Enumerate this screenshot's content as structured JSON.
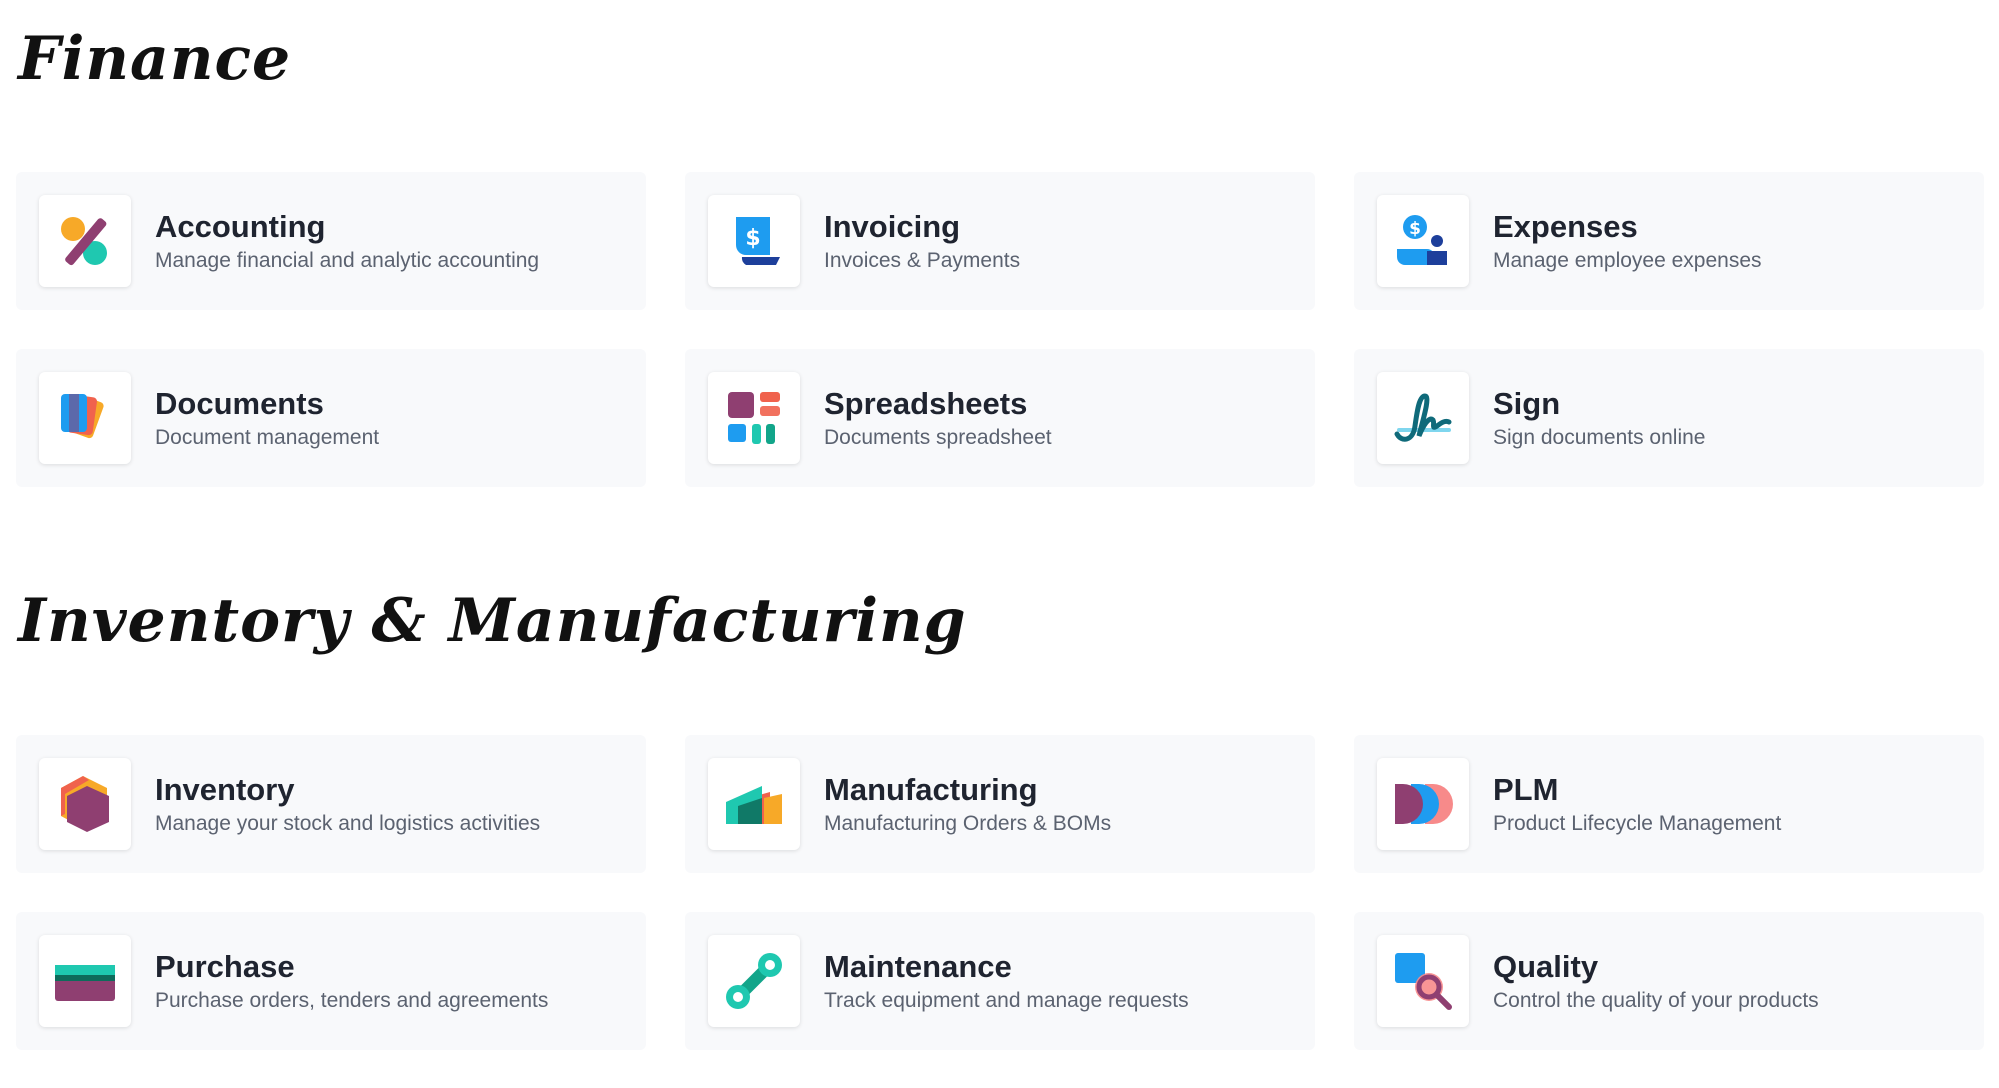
{
  "sections": [
    {
      "title": "Finance",
      "apps": [
        {
          "name": "Accounting",
          "desc": "Manage financial and analytic accounting",
          "icon": "accounting-icon"
        },
        {
          "name": "Invoicing",
          "desc": "Invoices & Payments",
          "icon": "invoicing-icon"
        },
        {
          "name": "Expenses",
          "desc": "Manage employee expenses",
          "icon": "expenses-icon"
        },
        {
          "name": "Documents",
          "desc": "Document management",
          "icon": "documents-icon"
        },
        {
          "name": "Spreadsheets",
          "desc": "Documents spreadsheet",
          "icon": "spreadsheets-icon"
        },
        {
          "name": "Sign",
          "desc": "Sign documents online",
          "icon": "sign-icon"
        }
      ]
    },
    {
      "title": "Inventory & Manufacturing",
      "apps": [
        {
          "name": "Inventory",
          "desc": "Manage your stock and logistics activities",
          "icon": "inventory-icon"
        },
        {
          "name": "Manufacturing",
          "desc": "Manufacturing Orders & BOMs",
          "icon": "manufacturing-icon"
        },
        {
          "name": "PLM",
          "desc": "Product Lifecycle Management",
          "icon": "plm-icon"
        },
        {
          "name": "Purchase",
          "desc": "Purchase orders, tenders and agreements",
          "icon": "purchase-icon"
        },
        {
          "name": "Maintenance",
          "desc": "Track equipment and manage requests",
          "icon": "maintenance-icon"
        },
        {
          "name": "Quality",
          "desc": "Control the quality of your products",
          "icon": "quality-icon"
        }
      ]
    }
  ],
  "colors": {
    "card_bg": "#f8f9fb",
    "title_text": "#1f2430",
    "desc_text": "#5b6270"
  }
}
